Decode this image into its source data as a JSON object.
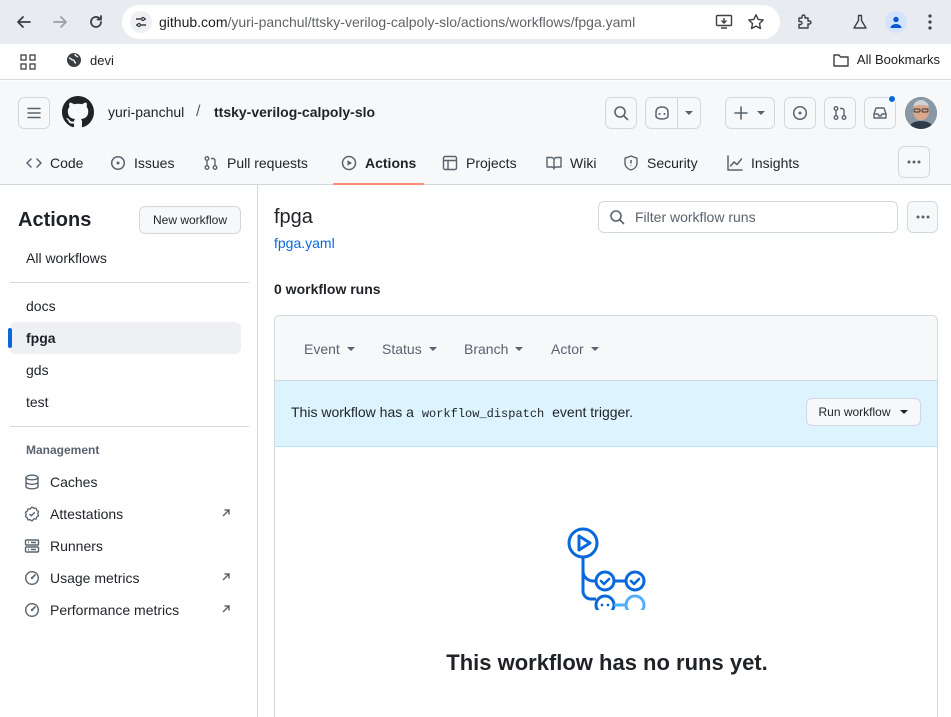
{
  "browser": {
    "url_host": "github.com",
    "url_path": "/yuri-panchul/ttsky-verilog-calpoly-slo/actions/workflows/fpga.yaml",
    "bookmark_folder": "devi",
    "all_bookmarks": "All Bookmarks"
  },
  "header": {
    "owner": "yuri-panchul",
    "separator": "/",
    "repo": "ttsky-verilog-calpoly-slo"
  },
  "tabs": [
    {
      "label": "Code"
    },
    {
      "label": "Issues"
    },
    {
      "label": "Pull requests"
    },
    {
      "label": "Actions"
    },
    {
      "label": "Projects"
    },
    {
      "label": "Wiki"
    },
    {
      "label": "Security"
    },
    {
      "label": "Insights"
    }
  ],
  "sidebar": {
    "title": "Actions",
    "new_workflow": "New workflow",
    "all_workflows": "All workflows",
    "workflows": [
      "docs",
      "fpga",
      "gds",
      "test"
    ],
    "management_title": "Management",
    "management": [
      {
        "label": "Caches"
      },
      {
        "label": "Attestations"
      },
      {
        "label": "Runners"
      },
      {
        "label": "Usage metrics"
      },
      {
        "label": "Performance metrics"
      }
    ]
  },
  "main": {
    "title": "fpga",
    "file": "fpga.yaml",
    "filter_placeholder": "Filter workflow runs",
    "run_count": "0 workflow runs",
    "filters": [
      "Event",
      "Status",
      "Branch",
      "Actor"
    ],
    "notice_prefix": "This workflow has a",
    "notice_code": "workflow_dispatch",
    "notice_suffix": "event trigger.",
    "run_workflow": "Run workflow",
    "empty_message": "This workflow has no runs yet."
  }
}
